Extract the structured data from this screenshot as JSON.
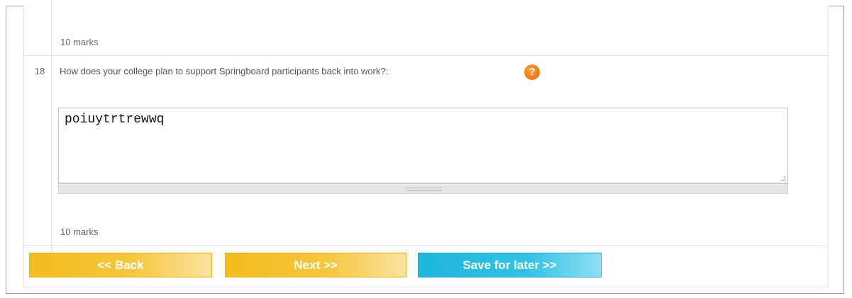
{
  "question_prev": {
    "marks_label": "10 marks"
  },
  "question": {
    "number": "18",
    "text": "How does your college plan to support Springboard participants back into work?:",
    "help_icon_glyph": "?",
    "help_icon": "help-circle-icon",
    "answer_value": "poiuytrtrewwq",
    "marks_label": "10 marks"
  },
  "nav": {
    "back_label": "<< Back",
    "next_label": "Next >>",
    "save_label": "Save for later >>"
  },
  "colors": {
    "button_yellow": "#f3bd1c",
    "button_blue": "#1eb6dc",
    "help_icon": "#e86a00"
  }
}
